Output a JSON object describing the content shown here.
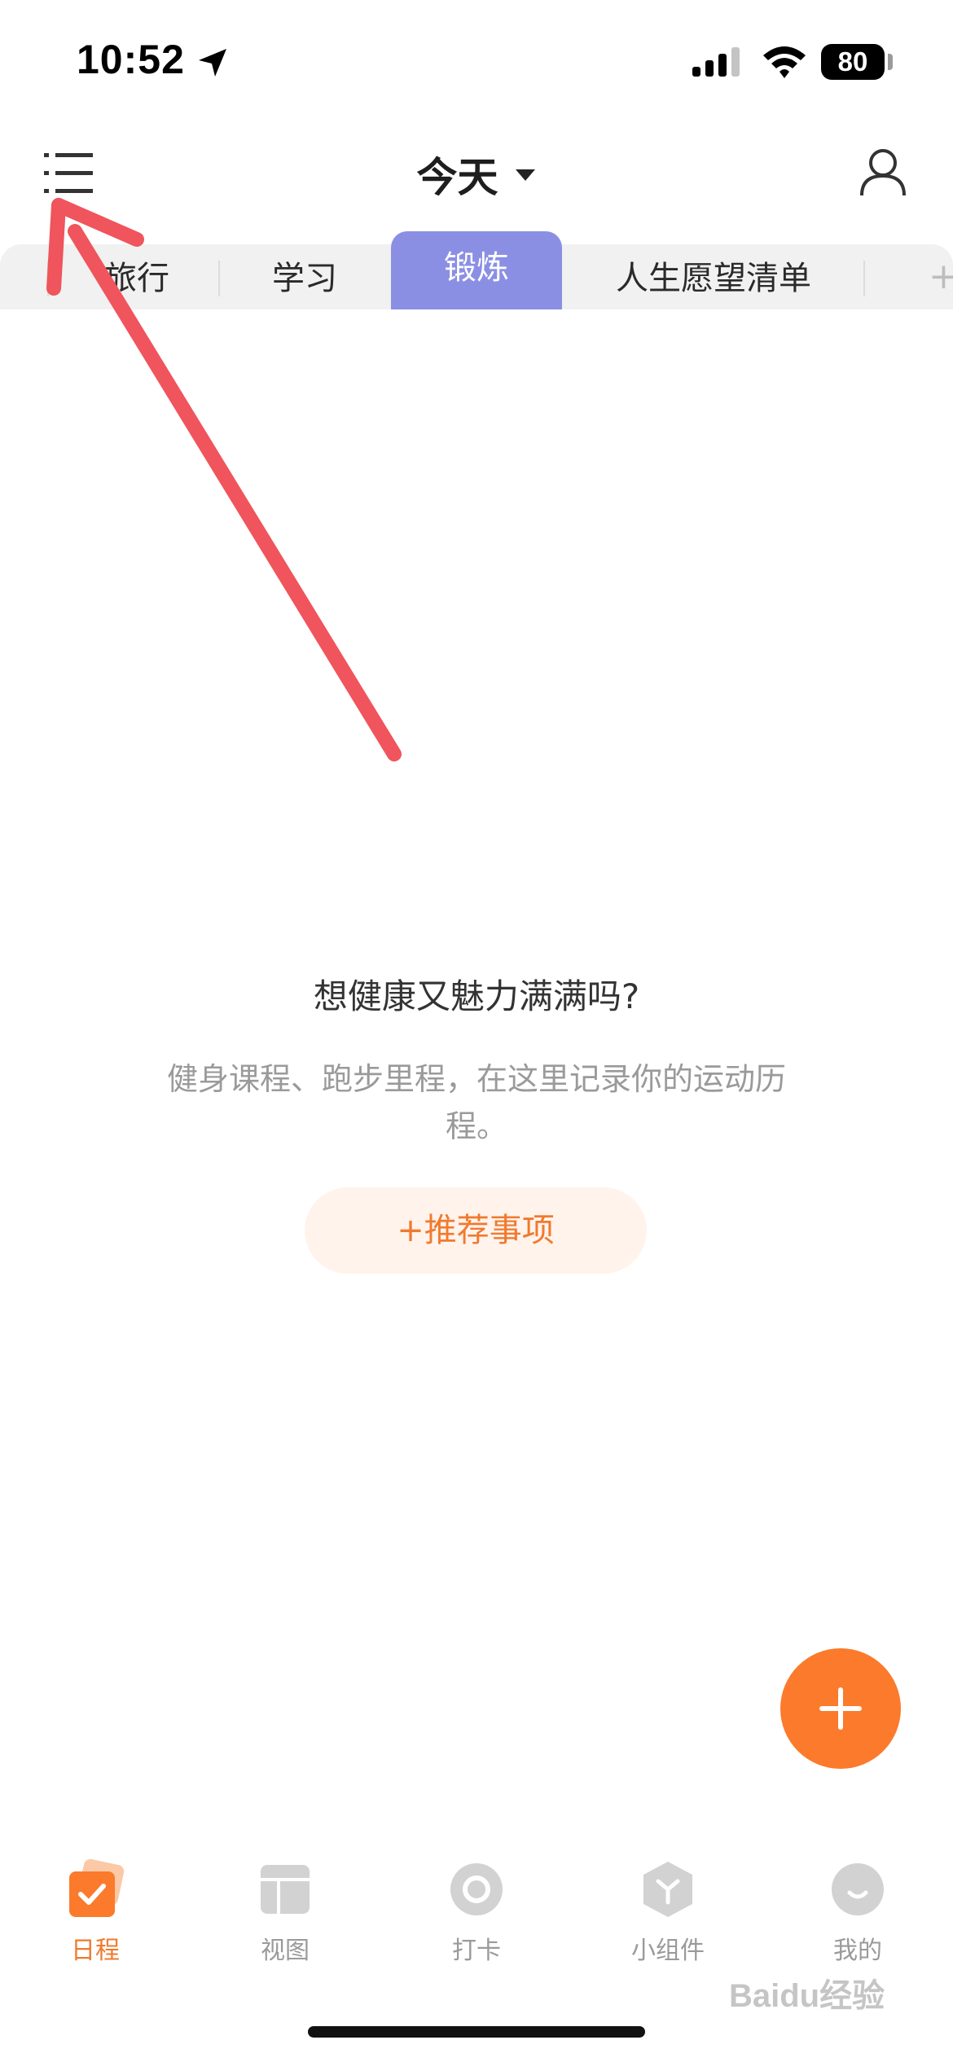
{
  "status_bar": {
    "time": "10:52",
    "battery": "80"
  },
  "header": {
    "title": "今天"
  },
  "tabs": [
    {
      "label": "旅行"
    },
    {
      "label": "学习"
    },
    {
      "label": "锻炼",
      "active": true
    },
    {
      "label": "人生愿望清单"
    }
  ],
  "add_tab_glyph": "+",
  "empty_state": {
    "title": "想健康又魅力满满吗?",
    "description": "健身课程、跑步里程，在这里记录你的运动历程。",
    "button_label": "+推荐事项"
  },
  "bottom_nav": [
    {
      "label": "日程",
      "icon": "schedule-check-icon",
      "active": true
    },
    {
      "label": "视图",
      "icon": "view-layout-icon"
    },
    {
      "label": "打卡",
      "icon": "checkin-ring-icon"
    },
    {
      "label": "小组件",
      "icon": "widget-cube-icon"
    },
    {
      "label": "我的",
      "icon": "profile-face-icon"
    }
  ],
  "colors": {
    "accent_orange": "#fb7a2b",
    "active_tab": "#8b8fe4",
    "annotation_arrow": "#f0545c"
  },
  "watermark": "Baidu经验"
}
